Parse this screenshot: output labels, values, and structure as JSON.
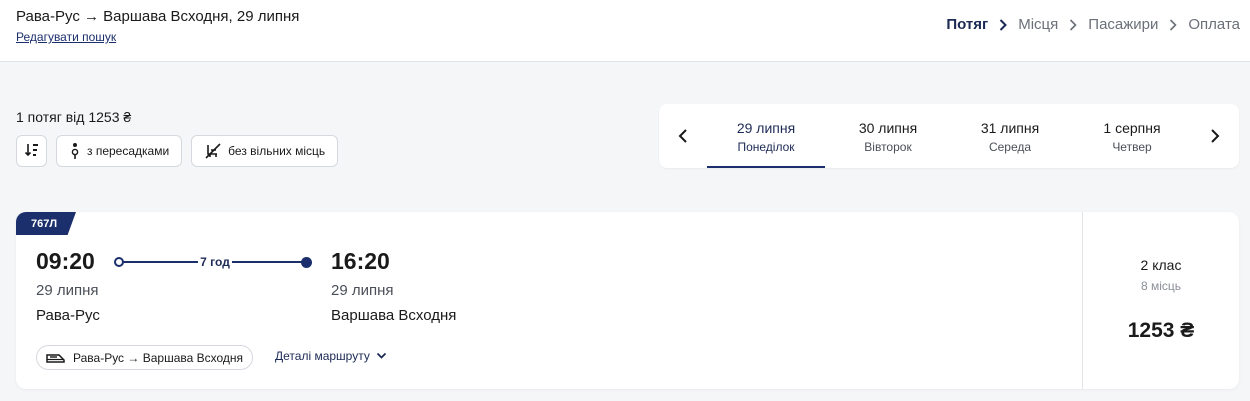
{
  "header": {
    "route_title": "Рава-Рус → Варшава Всходня, 29 липня",
    "edit_link": "Редагувати пошук",
    "steps": [
      "Потяг",
      "Місця",
      "Пасажири",
      "Оплата"
    ]
  },
  "summary": "1 потяг від 1253 ₴",
  "filters": {
    "with_transfers": "з пересадками",
    "no_free_seats": "без вільних місць"
  },
  "dates": [
    {
      "date": "29 липня",
      "weekday": "Понеділок"
    },
    {
      "date": "30 липня",
      "weekday": "Вівторок"
    },
    {
      "date": "31 липня",
      "weekday": "Середа"
    },
    {
      "date": "1 серпня",
      "weekday": "Четвер"
    }
  ],
  "train": {
    "number": "767Л",
    "departure": {
      "time": "09:20",
      "date": "29 липня",
      "station": "Рава-Рус"
    },
    "arrival": {
      "time": "16:20",
      "date": "29 липня",
      "station": "Варшава Всходня"
    },
    "duration": "7 год",
    "route": "Рава-Рус → Варшава Всходня",
    "details_link": "Деталі маршруту",
    "class": "2 клас",
    "seats": "8 місць",
    "price": "1253 ₴"
  },
  "colors": {
    "accent": "#1c2f6d",
    "background": "#f5f6f8"
  }
}
